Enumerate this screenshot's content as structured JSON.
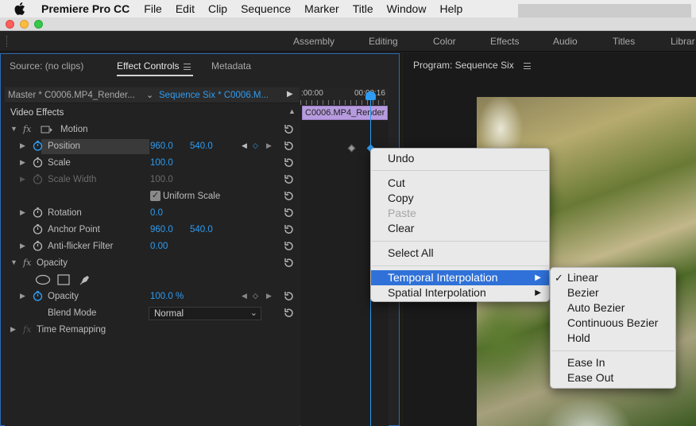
{
  "menubar": {
    "app_name": "Premiere Pro CC",
    "items": [
      "File",
      "Edit",
      "Clip",
      "Sequence",
      "Marker",
      "Title",
      "Window",
      "Help"
    ]
  },
  "workspaces": [
    "Assembly",
    "Editing",
    "Color",
    "Effects",
    "Audio",
    "Titles",
    "Librar"
  ],
  "left_panel": {
    "tabs": [
      "Source: (no clips)",
      "Effect Controls",
      "Metadata"
    ],
    "active_tab": "Effect Controls",
    "master_label": "Master * C0006.MP4_Render...",
    "sequence_label": "Sequence Six * C0006.M...",
    "section_title": "Video Effects",
    "motion": {
      "name": "Motion",
      "position_label": "Position",
      "position_x": "960.0",
      "position_y": "540.0",
      "scale_label": "Scale",
      "scale_value": "100.0",
      "scale_width_label": "Scale Width",
      "scale_width_value": "100.0",
      "uniform_scale_label": "Uniform Scale",
      "uniform_scale_checked": true,
      "rotation_label": "Rotation",
      "rotation_value": "0.0",
      "anchor_label": "Anchor Point",
      "anchor_x": "960.0",
      "anchor_y": "540.0",
      "antiflicker_label": "Anti-flicker Filter",
      "antiflicker_value": "0.00"
    },
    "opacity": {
      "name": "Opacity",
      "opacity_label": "Opacity",
      "opacity_value": "100.0 %",
      "blend_label": "Blend Mode",
      "blend_value": "Normal"
    },
    "time_remapping": "Time Remapping",
    "timeline": {
      "time_start": ":00:00",
      "time_playhead": "00:00:16",
      "clip_name": "C0006.MP4_Render"
    }
  },
  "right_panel": {
    "title": "Program: Sequence Six"
  },
  "context_menu": {
    "undo": "Undo",
    "cut": "Cut",
    "copy": "Copy",
    "paste": "Paste",
    "clear": "Clear",
    "select_all": "Select All",
    "temporal": "Temporal Interpolation",
    "spatial": "Spatial Interpolation"
  },
  "submenu": {
    "linear": "Linear",
    "bezier": "Bezier",
    "auto_bezier": "Auto Bezier",
    "continuous_bezier": "Continuous Bezier",
    "hold": "Hold",
    "ease_in": "Ease In",
    "ease_out": "Ease Out",
    "checked_item": "Linear"
  },
  "colors": {
    "accent_blue": "#2e9cf2",
    "menu_highlight": "#2f71d8",
    "clip_purple": "#b79bde",
    "panel_bg": "#232323"
  }
}
